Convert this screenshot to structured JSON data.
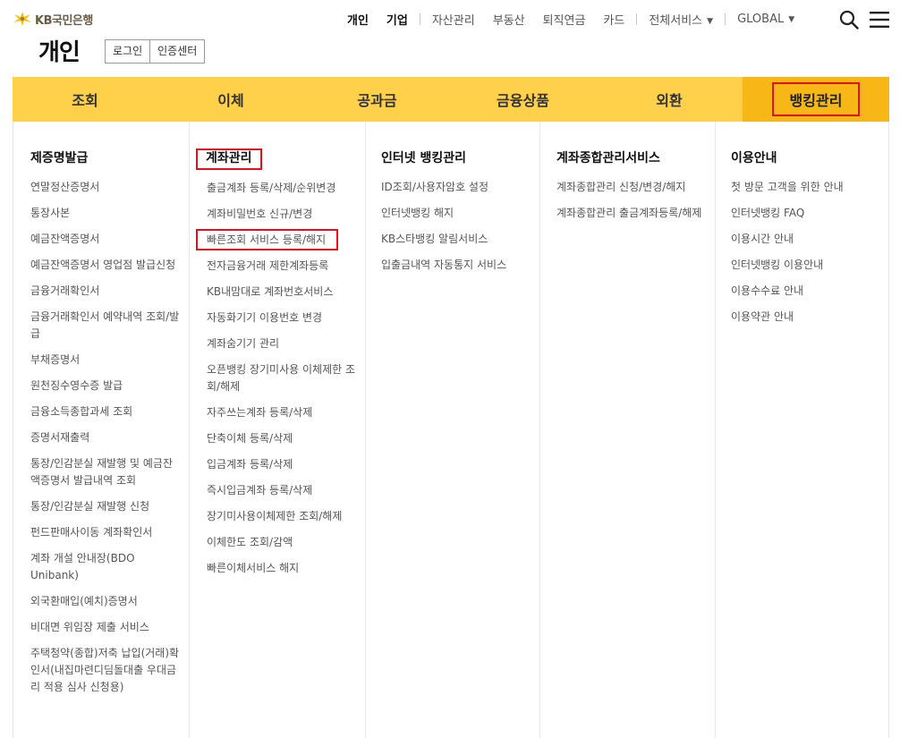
{
  "brand": {
    "logo_text": "KB국민은행"
  },
  "top_nav": {
    "items": [
      "개인",
      "기업",
      "자산관리",
      "부동산",
      "퇴직연금",
      "카드",
      "전체서비스",
      "GLOBAL"
    ]
  },
  "page": {
    "title": "개인",
    "login_label": "로그인",
    "cert_label": "인증센터"
  },
  "gnb": {
    "tabs": [
      "조회",
      "이체",
      "공과금",
      "금융상품",
      "외환",
      "뱅킹관리"
    ],
    "active_tab": "뱅킹관리"
  },
  "colors": {
    "gnb_bg": "#ffd04a",
    "gnb_active": "#f7b817",
    "highlight_border": "#e4101b"
  },
  "menu": {
    "col1": {
      "title": "제증명발급",
      "items": [
        "연말정산증명서",
        "통장사본",
        "예금잔액증명서",
        "예금잔액증명서 영업점 발급신청",
        "금융거래확인서",
        "금융거래확인서 예약내역 조회/발급",
        "부채증명서",
        "원천징수영수증 발급",
        "금융소득종합과세 조회",
        "증명서재출력",
        "통장/인감분실 재발행 및 예금잔액증명서 발급내역 조회",
        "통장/인감분실 재발행 신청",
        "펀드판매사이동 계좌확인서",
        "계좌 개설 안내장(BDO Unibank)",
        "외국환매입(예치)증명서",
        "비대면 위임장 제출 서비스",
        "주택청약(종합)저축 납입(거래)확인서(내집마련디딤돌대출 우대금리 적용 심사 신청용)"
      ]
    },
    "col2": {
      "title": "계좌관리",
      "items": [
        "출금계좌 등록/삭제/순위변경",
        "계좌비밀번호 신규/변경",
        "빠른조회 서비스 등록/해지",
        "전자금융거래 제한계좌등록",
        "KB내맘대로 계좌번호서비스",
        "자동화기기 이용번호 변경",
        "계좌숨기기 관리",
        "오픈뱅킹 장기미사용 이체제한 조회/해제",
        "자주쓰는계좌 등록/삭제",
        "단축이체 등록/삭제",
        "입금계좌 등록/삭제",
        "즉시입금계좌 등록/삭제",
        "장기미사용이체제한 조회/해제",
        "이체한도 조회/감액",
        "빠른이체서비스 해지"
      ]
    },
    "col3": {
      "title": "인터넷 뱅킹관리",
      "items": [
        "ID조회/사용자암호 설정",
        "인터넷뱅킹 해지",
        "KB스타뱅킹 알림서비스",
        "입출금내역 자동통지 서비스"
      ]
    },
    "col4": {
      "title": "계좌종합관리서비스",
      "items": [
        "계좌종합관리 신청/변경/해지",
        "계좌종합관리 출금계좌등록/해제"
      ]
    },
    "col5": {
      "title": "이용안내",
      "items": [
        "첫 방문 고객을 위한 안내",
        "인터넷뱅킹 FAQ",
        "이용시간 안내",
        "인터넷뱅킹 이용안내",
        "이용수수료 안내",
        "이용약관 안내"
      ]
    }
  }
}
